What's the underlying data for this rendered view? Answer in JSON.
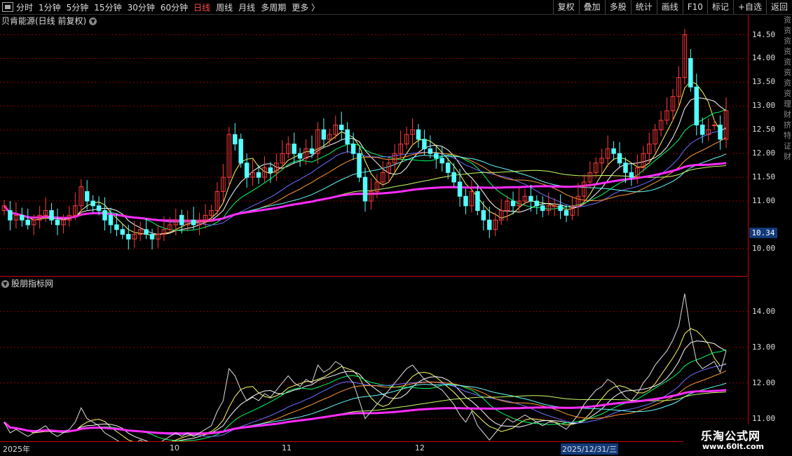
{
  "toolbar": {
    "periods": [
      "分时",
      "1分钟",
      "5分钟",
      "15分钟",
      "30分钟",
      "60分钟",
      "日线",
      "周线",
      "月线",
      "多周期",
      "更多 〉"
    ],
    "active_period": "日线",
    "tools": [
      "复权",
      "叠加",
      "多股",
      "统计",
      "画线",
      "F10",
      "标记",
      "+自选",
      "返回"
    ]
  },
  "main": {
    "title": "贝肯能源(日线 前复权)",
    "price_tag": "10.34",
    "yticks": [
      "14.50",
      "14.00",
      "13.50",
      "13.00",
      "12.50",
      "12.00",
      "11.50",
      "11.00",
      "10.00"
    ],
    "side_text": "资资资资资资资资 理财 挤 特 证 财"
  },
  "sub": {
    "title": "股朋指标网",
    "yticks": [
      "14.00",
      "13.00",
      "12.00",
      "11.00"
    ]
  },
  "dates": {
    "labels": [
      "2025年",
      "10",
      "11",
      "12"
    ],
    "selected": "2025/12/31/三"
  },
  "watermark": {
    "name": "乐淘公式网",
    "url": "www.60lt.com"
  },
  "colors": {
    "up": "#ff3b3b",
    "down": "#54ffff",
    "ma_long": "#ff2cff",
    "grid": "#8b0000"
  },
  "chart_data": {
    "type": "candlestick",
    "ylim_main": [
      9.6,
      14.7
    ],
    "ylim_sub": [
      10.6,
      14.8
    ],
    "close": [
      10.9,
      10.6,
      10.7,
      10.6,
      10.5,
      10.6,
      10.7,
      10.8,
      10.6,
      10.5,
      10.6,
      10.7,
      10.9,
      11.3,
      11.0,
      10.9,
      10.8,
      10.6,
      10.5,
      10.4,
      10.3,
      10.2,
      10.3,
      10.4,
      10.3,
      10.2,
      10.3,
      10.4,
      10.5,
      10.6,
      10.5,
      10.6,
      10.5,
      10.6,
      10.7,
      10.8,
      11.2,
      11.5,
      12.4,
      12.2,
      11.8,
      11.5,
      11.6,
      11.5,
      11.7,
      11.6,
      11.8,
      12.0,
      12.2,
      12.0,
      11.9,
      12.1,
      12.0,
      12.5,
      12.3,
      12.4,
      12.6,
      12.5,
      12.2,
      12.0,
      11.5,
      11.0,
      11.2,
      11.4,
      11.6,
      11.8,
      12.0,
      12.2,
      12.4,
      12.5,
      12.3,
      12.1,
      12.0,
      11.9,
      11.8,
      11.6,
      11.4,
      11.1,
      10.9,
      11.2,
      10.8,
      10.6,
      10.4,
      10.6,
      10.8,
      11.0,
      10.9,
      11.0,
      11.1,
      11.0,
      10.9,
      10.8,
      10.9,
      10.9,
      10.8,
      10.7,
      10.9,
      11.1,
      11.4,
      11.6,
      11.8,
      11.9,
      12.1,
      12.0,
      11.8,
      11.6,
      11.5,
      11.7,
      12.0,
      12.2,
      12.5,
      12.7,
      12.9,
      13.2,
      13.6,
      14.5,
      13.4,
      12.6,
      12.4,
      12.5,
      12.6,
      12.3,
      12.9
    ],
    "open": [
      10.8,
      10.8,
      10.6,
      10.7,
      10.6,
      10.5,
      10.6,
      10.7,
      10.8,
      10.6,
      10.5,
      10.6,
      10.7,
      10.9,
      11.2,
      11.0,
      10.9,
      10.8,
      10.7,
      10.5,
      10.4,
      10.3,
      10.2,
      10.3,
      10.4,
      10.3,
      10.2,
      10.3,
      10.4,
      10.5,
      10.7,
      10.5,
      10.6,
      10.5,
      10.6,
      10.7,
      10.8,
      11.2,
      11.5,
      12.4,
      12.3,
      11.8,
      11.5,
      11.6,
      11.5,
      11.7,
      11.6,
      11.8,
      12.0,
      12.2,
      12.0,
      11.9,
      12.1,
      12.0,
      12.5,
      12.3,
      12.4,
      12.6,
      12.5,
      12.2,
      12.0,
      11.5,
      11.0,
      11.2,
      11.4,
      11.6,
      11.8,
      12.0,
      12.2,
      12.4,
      12.5,
      12.3,
      12.1,
      12.0,
      11.9,
      11.8,
      11.6,
      11.4,
      11.1,
      10.9,
      11.2,
      10.8,
      10.6,
      10.4,
      10.6,
      10.8,
      11.0,
      10.9,
      11.0,
      11.1,
      11.0,
      10.9,
      10.8,
      10.9,
      10.9,
      10.8,
      10.7,
      10.9,
      11.1,
      11.4,
      11.6,
      11.8,
      11.9,
      12.1,
      12.0,
      11.8,
      11.6,
      11.5,
      11.7,
      12.0,
      12.2,
      12.5,
      12.7,
      12.9,
      13.2,
      13.6,
      14.0,
      13.4,
      12.6,
      12.4,
      12.6,
      12.6,
      12.3
    ]
  }
}
